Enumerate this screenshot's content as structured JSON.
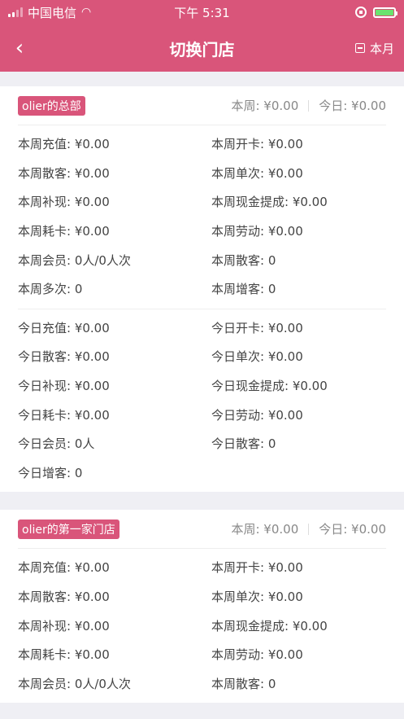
{
  "status_bar": {
    "carrier": "中国电信",
    "time": "下午 5:31"
  },
  "nav": {
    "back_icon": "‹",
    "title": "切换门店",
    "right_label": "本月"
  },
  "stores": [
    {
      "name": "olier的总部",
      "week_summary": "本周: ¥0.00",
      "today_summary": "今日: ¥0.00",
      "week_items": [
        "本周充值: ¥0.00",
        "本周开卡: ¥0.00",
        "本周散客: ¥0.00",
        "本周单次: ¥0.00",
        "本周补现: ¥0.00",
        "本周现金提成: ¥0.00",
        "本周耗卡: ¥0.00",
        "本周劳动: ¥0.00",
        "本周会员: 0人/0人次",
        "本周散客: 0",
        "本周多次: 0",
        "本周增客: 0"
      ],
      "today_items": [
        "今日充值: ¥0.00",
        "今日开卡: ¥0.00",
        "今日散客: ¥0.00",
        "今日单次: ¥0.00",
        "今日补现: ¥0.00",
        "今日现金提成: ¥0.00",
        "今日耗卡: ¥0.00",
        "今日劳动: ¥0.00",
        "今日会员: 0人",
        "今日散客: 0",
        "今日增客: 0"
      ]
    },
    {
      "name": "olier的第一家门店",
      "week_summary": "本周: ¥0.00",
      "today_summary": "今日: ¥0.00",
      "week_items": [
        "本周充值: ¥0.00",
        "本周开卡: ¥0.00",
        "本周散客: ¥0.00",
        "本周单次: ¥0.00",
        "本周补现: ¥0.00",
        "本周现金提成: ¥0.00",
        "本周耗卡: ¥0.00",
        "本周劳动: ¥0.00",
        "本周会员: 0人/0人次",
        "本周散客: 0"
      ]
    }
  ],
  "colors": {
    "accent": "#d9557a",
    "battery": "#6ae36f"
  }
}
